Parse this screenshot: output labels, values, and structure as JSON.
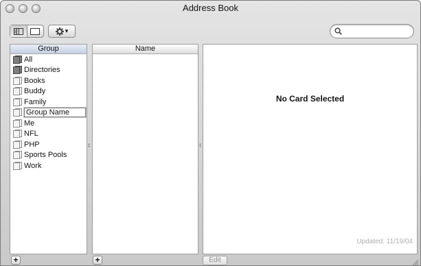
{
  "window": {
    "title": "Address Book"
  },
  "toolbar": {
    "view_buttons": [
      {
        "icon": "columns-view-icon"
      },
      {
        "icon": "card-view-icon"
      }
    ],
    "action_menu": {
      "icon": "gear-icon",
      "caret": "▾"
    },
    "search": {
      "value": "",
      "placeholder": ""
    }
  },
  "group_pane": {
    "header": "Group",
    "items": [
      {
        "label": "All",
        "icon": "group-dark-icon"
      },
      {
        "label": "Directories",
        "icon": "group-dark-icon"
      },
      {
        "label": "Books",
        "icon": "group-icon"
      },
      {
        "label": "Buddy",
        "icon": "group-icon"
      },
      {
        "label": "Family",
        "icon": "group-icon"
      },
      {
        "label": "Group Name",
        "icon": "group-icon",
        "editing": true
      },
      {
        "label": "Me",
        "icon": "group-icon"
      },
      {
        "label": "NFL",
        "icon": "group-icon"
      },
      {
        "label": "PHP",
        "icon": "group-icon"
      },
      {
        "label": "Sports Pools",
        "icon": "group-icon"
      },
      {
        "label": "Work",
        "icon": "group-icon"
      }
    ]
  },
  "name_pane": {
    "header": "Name",
    "items": []
  },
  "card_pane": {
    "empty_message": "No Card Selected",
    "updated": "Updated: 11/19/04"
  },
  "bottom": {
    "add_label": "+",
    "edit_label": "Edit"
  }
}
